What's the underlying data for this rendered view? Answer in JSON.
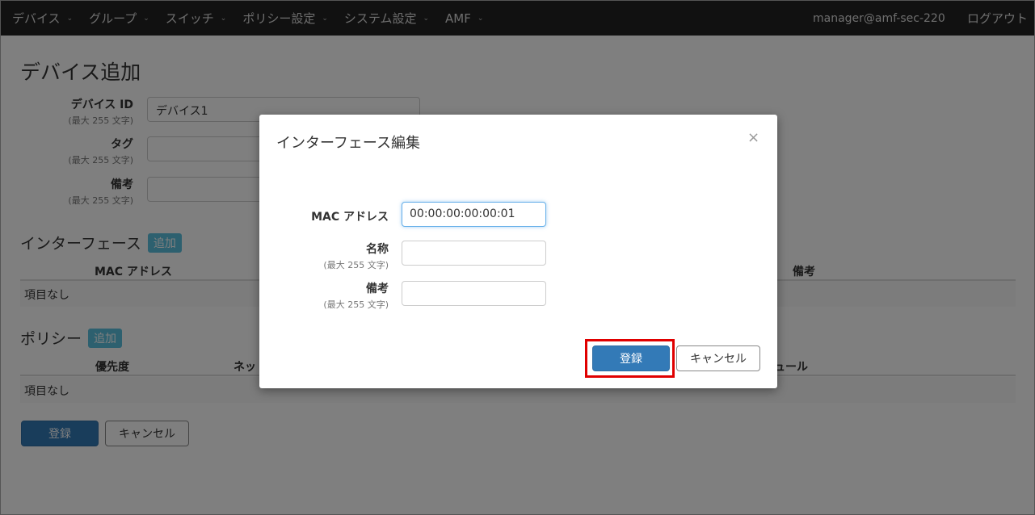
{
  "navbar": {
    "items": [
      {
        "label": "デバイス"
      },
      {
        "label": "グループ"
      },
      {
        "label": "スイッチ"
      },
      {
        "label": "ポリシー設定"
      },
      {
        "label": "システム設定"
      },
      {
        "label": "AMF"
      }
    ],
    "caret": "⌄",
    "user": "manager@amf-sec-220",
    "logout": "ログアウト"
  },
  "page": {
    "title": "デバイス追加",
    "fields": [
      {
        "label": "デバイス ID",
        "hint": "(最大 255 文字)",
        "value": "デバイス1"
      },
      {
        "label": "タグ",
        "hint": "(最大 255 文字)",
        "value": ""
      },
      {
        "label": "備考",
        "hint": "(最大 255 文字)",
        "value": ""
      }
    ],
    "interfaces": {
      "title": "インターフェース",
      "add_label": "追加",
      "columns": [
        "MAC アドレス",
        "備考"
      ],
      "empty_text": "項目なし"
    },
    "policies": {
      "title": "ポリシー",
      "add_label": "追加",
      "columns": [
        "優先度",
        "ネッ",
        "ュール"
      ],
      "empty_text": "項目なし"
    },
    "register_label": "登録",
    "cancel_label": "キャンセル"
  },
  "modal": {
    "title": "インターフェース編集",
    "close": "×",
    "fields": [
      {
        "label": "MAC アドレス",
        "hint": "",
        "value": "00:00:00:00:00:01"
      },
      {
        "label": "名称",
        "hint": "(最大 255 文字)",
        "value": ""
      },
      {
        "label": "備考",
        "hint": "(最大 255 文字)",
        "value": ""
      }
    ],
    "register_label": "登録",
    "cancel_label": "キャンセル"
  },
  "colors": {
    "navbar_bg": "#222222",
    "primary": "#337ab7",
    "info": "#5bc0de",
    "highlight": "#e00000"
  }
}
